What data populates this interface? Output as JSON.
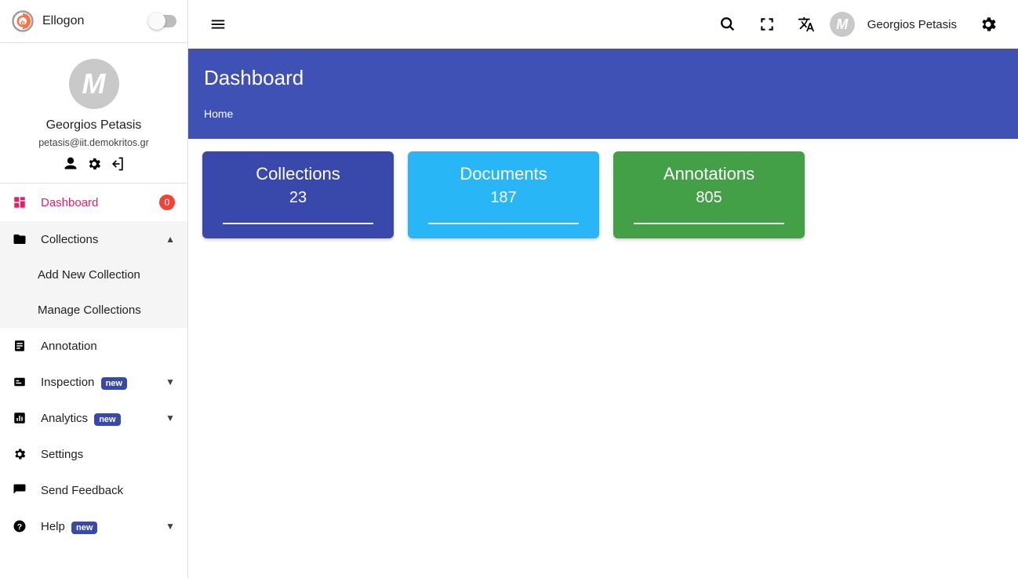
{
  "brand": {
    "name": "Ellogon"
  },
  "profile": {
    "avatar_letter": "M",
    "name": "Georgios Petasis",
    "email": "petasis@iit.demokritos.gr"
  },
  "sidebar": {
    "dashboard": {
      "label": "Dashboard",
      "badge": "0"
    },
    "collections": {
      "label": "Collections",
      "children": {
        "add": "Add New Collection",
        "manage": "Manage Collections"
      }
    },
    "annotation": {
      "label": "Annotation"
    },
    "inspection": {
      "label": "Inspection",
      "tag": "new"
    },
    "analytics": {
      "label": "Analytics",
      "tag": "new"
    },
    "settings": {
      "label": "Settings"
    },
    "feedback": {
      "label": "Send Feedback"
    },
    "help": {
      "label": "Help",
      "tag": "new"
    }
  },
  "topbar": {
    "username": "Georgios Petasis",
    "avatar_letter": "M"
  },
  "page": {
    "title": "Dashboard",
    "breadcrumb": "Home"
  },
  "cards": {
    "collections": {
      "title": "Collections",
      "value": "23"
    },
    "documents": {
      "title": "Documents",
      "value": "187"
    },
    "annotations": {
      "title": "Annotations",
      "value": "805"
    }
  }
}
